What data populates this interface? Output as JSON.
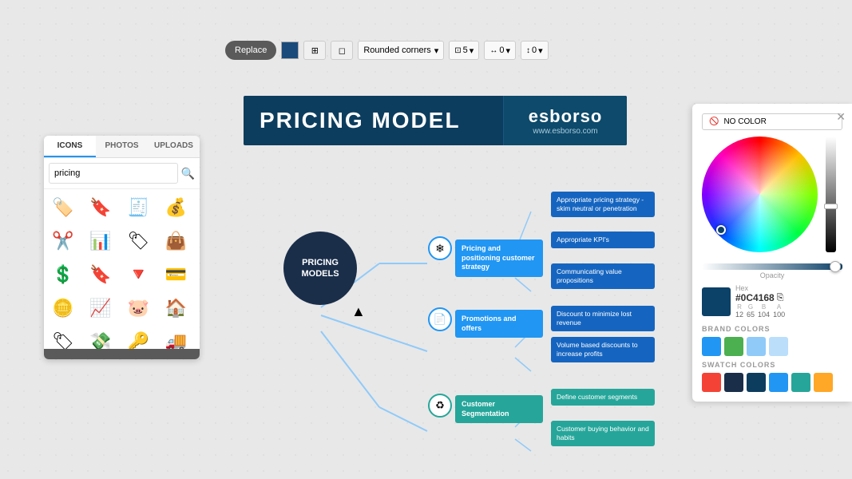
{
  "toolbar": {
    "replace_label": "Replace",
    "shape_select": "Rounded corners",
    "size_value": "5",
    "width_value": "0",
    "height_value": "0"
  },
  "left_panel": {
    "tabs": [
      "ICONS",
      "PHOTOS",
      "UPLOADS"
    ],
    "active_tab": "ICONS",
    "search_placeholder": "pricing",
    "icons": [
      {
        "name": "price-tag-red",
        "emoji": "🏷️"
      },
      {
        "name": "price-tag-blue",
        "emoji": "🔖"
      },
      {
        "name": "cash-register",
        "emoji": "🧾"
      },
      {
        "name": "coins-icon",
        "emoji": "💰"
      },
      {
        "name": "percent-icon",
        "emoji": "✂️"
      },
      {
        "name": "chart-icon",
        "emoji": "📊"
      },
      {
        "name": "tag-icon",
        "emoji": "🏷"
      },
      {
        "name": "bag-icon",
        "emoji": "👜"
      },
      {
        "name": "dollar-circle",
        "emoji": "💲"
      },
      {
        "name": "tag-check",
        "emoji": "🔖"
      },
      {
        "name": "price-reduce",
        "emoji": "🔻"
      },
      {
        "name": "wallet-icon",
        "emoji": "💳"
      },
      {
        "name": "coin-gold",
        "emoji": "🪙"
      },
      {
        "name": "price-up",
        "emoji": "📈"
      },
      {
        "name": "piggy-bank",
        "emoji": "🐷"
      },
      {
        "name": "house-price",
        "emoji": "🏠"
      },
      {
        "name": "sale-tag",
        "emoji": "🏷"
      },
      {
        "name": "discount-tag",
        "emoji": "💸"
      },
      {
        "name": "price-label",
        "emoji": "🔑"
      },
      {
        "name": "truck-icon",
        "emoji": "🚚"
      }
    ]
  },
  "header": {
    "title": "PRICING MODEL",
    "brand_name": "esborso",
    "brand_url": "www.esborso.com"
  },
  "mindmap": {
    "center": "PRICING\nMODELS",
    "branches": [
      {
        "id": "branch1",
        "label": "Pricing and positioning\ncustomer strategy",
        "icon": "❄️",
        "leaves": [
          "Appropriate pricing strategy - skim neutral or penetration",
          "Appropriate KPI's",
          "Communicating value propositions"
        ],
        "leaf_color": "blue"
      },
      {
        "id": "branch2",
        "label": "Promotions and offers",
        "icon": "📄",
        "leaves": [
          "Discount to minimize lost revenue",
          "Volume based discounts to increase profits"
        ],
        "leaf_color": "blue"
      },
      {
        "id": "branch3",
        "label": "Customer Segmentation",
        "icon": "♻️",
        "leaves": [
          "Define customer segments",
          "Customer buying behavior and habits"
        ],
        "leaf_color": "green"
      }
    ]
  },
  "color_picker": {
    "no_color_label": "NO COLOR",
    "opacity_label": "Opacity",
    "hex_label": "Hex",
    "hex_value": "#0C4168",
    "r_label": "R",
    "r_value": "12",
    "g_label": "G",
    "g_value": "65",
    "b_label": "B",
    "b_value": "104",
    "a_label": "A",
    "a_value": "100",
    "brand_colors_label": "BRAND COLORS",
    "brand_colors": [
      "#2196F3",
      "#4CAF50",
      "#90CAF9",
      "#BBDEFB"
    ],
    "swatch_colors_label": "SWATCH COLORS",
    "swatch_colors": [
      "#F44336",
      "#1A2E4A",
      "#0D3D5E",
      "#2196F3",
      "#26A69A",
      "#FFA726"
    ]
  }
}
